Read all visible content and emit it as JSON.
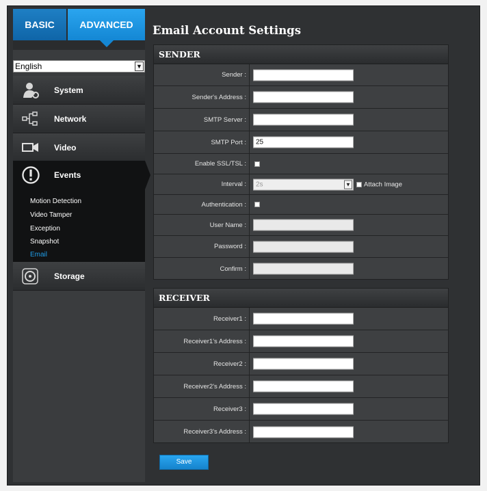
{
  "mode_tabs": {
    "basic": "BASIC",
    "advanced": "ADVANCED"
  },
  "language": {
    "selected": "English"
  },
  "nav": {
    "system": "System",
    "network": "Network",
    "video": "Video",
    "events": "Events",
    "storage": "Storage"
  },
  "events_sub": {
    "motion_detection": "Motion Detection",
    "video_tamper": "Video Tamper",
    "exception": "Exception",
    "snapshot": "Snapshot",
    "email": "Email"
  },
  "page": {
    "title": "Email Account Settings"
  },
  "sender": {
    "header": "SENDER",
    "sender_label": "Sender :",
    "sender_value": "",
    "address_label": "Sender's Address :",
    "address_value": "",
    "smtp_server_label": "SMTP Server :",
    "smtp_server_value": "",
    "smtp_port_label": "SMTP Port :",
    "smtp_port_value": "25",
    "ssl_label": "Enable SSL/TSL :",
    "interval_label": "Interval :",
    "interval_value": "2s",
    "attach_label": "Attach Image",
    "auth_label": "Authentication :",
    "username_label": "User Name :",
    "password_label": "Password :",
    "confirm_label": "Confirm :"
  },
  "receiver": {
    "header": "RECEIVER",
    "r1_label": "Receiver1 :",
    "r1_addr_label": "Receiver1's Address :",
    "r2_label": "Receiver2 :",
    "r2_addr_label": "Receiver2's Address :",
    "r3_label": "Receiver3 :",
    "r3_addr_label": "Receiver3's Address :"
  },
  "actions": {
    "save": "Save"
  }
}
